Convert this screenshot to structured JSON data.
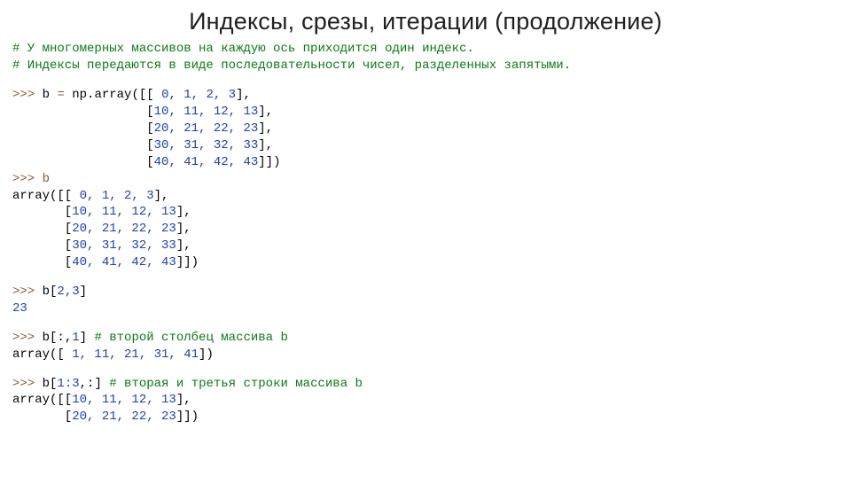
{
  "title": "Индексы, срезы, итерации (продолжение)",
  "comment1": "# У многомерных массивов на каждую ось приходится один индекс.",
  "comment2": "# Индексы передаются в виде последовательности чисел, разделенных запятыми.",
  "def_prompt": ">>>",
  "def_lhs": " b ",
  "def_eq": "=",
  "def_fun": " np.array([[ ",
  "def_r0": "0, 1, 2, 3",
  "def_r_tail": "],",
  "def_ind": "                  [",
  "def_r1": "10, 11, 12, 13",
  "def_r2": "20, 21, 22, 23",
  "def_r3": "30, 31, 32, 33",
  "def_r4": "40, 41, 42, 43",
  "def_close": "]])",
  "show_prompt": ">>> b",
  "show_open": "array([[ ",
  "show_r0": "0, 1, 2, 3",
  "show_tail": "],",
  "show_ind": "       [",
  "show_r1": "10, 11, 12, 13",
  "show_r2": "20, 21, 22, 23",
  "show_r3": "30, 31, 32, 33",
  "show_r4": "40, 41, 42, 43",
  "show_close": "]])",
  "idx_prompt": ">>> ",
  "idx_expr1": "b[",
  "idx_expr2": "2,3",
  "idx_expr3": "]",
  "idx_out": "23",
  "col_prompt": ">>> ",
  "col_expr1": "b[:,",
  "col_expr2": "1",
  "col_expr3": "] ",
  "col_comment": "# второй столбец массива b",
  "col_out1": "array([ ",
  "col_out2": "1, 11, 21, 31, 41",
  "col_out3": "])",
  "row_prompt": ">>> ",
  "row_expr1": "b[",
  "row_expr2": "1:3",
  "row_expr3": ",:] ",
  "row_comment": "# вторая и третья строки массива b",
  "row_out_open": "array([[",
  "row_out_r1": "10, 11, 12, 13",
  "row_out_tail": "],",
  "row_out_ind": "       [",
  "row_out_r2": "20, 21, 22, 23",
  "row_out_close": "]])"
}
